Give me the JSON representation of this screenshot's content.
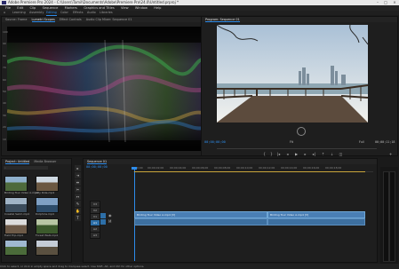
{
  "title_bar": {
    "title": "Adobe Premiere Pro 2024 - C:\\Users\\Tamil\\Documents\\Adobe\\Premiere Pro\\24.0\\Untitled.prproj *"
  },
  "menu": [
    "File",
    "Edit",
    "Clip",
    "Sequence",
    "Markers",
    "Graphics and Titles",
    "View",
    "Window",
    "Help"
  ],
  "workspaces": [
    "Learning",
    "Assembly",
    "Editing",
    "Color",
    "Effects",
    "Audio",
    "Libraries"
  ],
  "source_panel": {
    "tabs": [
      "Source: Frame",
      "Lumetri Scopes",
      "Effect Controls",
      "Audio Clip Mixer: Sequence 01"
    ],
    "scale_left": [
      "100",
      "90",
      "80",
      "70",
      "60",
      "50",
      "40",
      "30",
      "20",
      "10",
      "0"
    ]
  },
  "program_panel": {
    "tab": "Program: Sequence 01",
    "timecode_left": "00;00;00;00",
    "fit": "Fit",
    "quality": "Full",
    "timecode_right": "00;00;11;18"
  },
  "project_panel": {
    "tabs": [
      "Project: Untitled",
      "Media Browser"
    ],
    "search_placeholder": "",
    "items": [
      {
        "name": "Birding Tour Video A.mp4",
        "duration": "11;18"
      },
      {
        "name": "City Ride.mp4",
        "duration": "10;05"
      },
      {
        "name": "Coastal Swim.mp4",
        "duration": "8;12"
      },
      {
        "name": "Dolphins.mp4",
        "duration": "9;00"
      },
      {
        "name": "Field Trip.mp4",
        "duration": "6;21"
      },
      {
        "name": "Forest Walk.mp4",
        "duration": "7;14"
      }
    ]
  },
  "timeline_panel": {
    "tab": "Sequence 01",
    "timecode": "00;00;00;00",
    "ruler": [
      "00;00",
      "00;00;02;00",
      "00;00;04;00",
      "00;00;06;00",
      "00;00;08;00",
      "00;00;10;00",
      "00;00;12;00",
      "00;00;14;00",
      "00;00;16;00",
      "00;00;18;00"
    ],
    "tracks": [
      "V3",
      "V2",
      "V1",
      "A1",
      "A2",
      "A3"
    ],
    "clip_a_label": "Birding Tour Video A.mp4 [V]",
    "clip_b_label": "Birding Tour Video A.mp4 [V]"
  },
  "status_bar": "Click to select, or click in empty space and drag to marquee select. Use Shift, Alt, and Ctrl for other options.",
  "colors": {
    "accent": "#2d8ceb",
    "clip": "#4a7fb5",
    "audio_clip": "#3d6f9f"
  }
}
